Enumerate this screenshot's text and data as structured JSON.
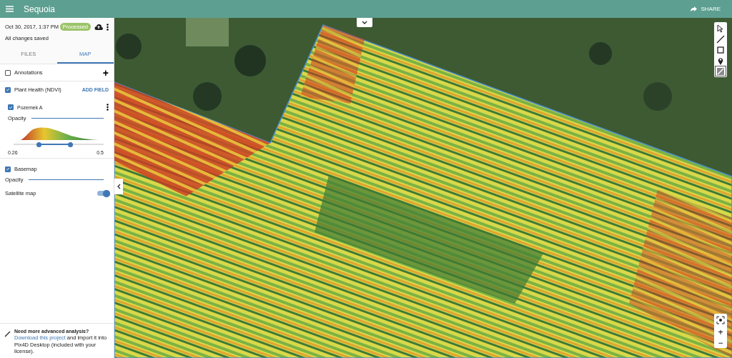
{
  "app_bar": {
    "title": "Sequoia",
    "share_label": "SHARE"
  },
  "project": {
    "date": "Oct 30, 2017, 1:37 PM",
    "status": "Processed",
    "saved_note": "All changes saved"
  },
  "tabs": [
    {
      "label": "FILES",
      "selected": false
    },
    {
      "label": "MAP",
      "selected": true
    }
  ],
  "layers": {
    "annotations": {
      "label": "Annotations",
      "checked": false,
      "action": "+"
    },
    "plant_health": {
      "label": "Plant Health (NDVI)",
      "checked": true,
      "action": "ADD FIELD",
      "fields": [
        {
          "label": "Pozemek A",
          "checked": true,
          "opacity": {
            "label": "Opacity",
            "level": 1
          },
          "range": {
            "thumbs": [
              {
                "level": 0.28
              },
              {
                "level": 0.63
              }
            ],
            "min_label": "0.26",
            "max_label": "0.5"
          }
        }
      ]
    },
    "basemap": {
      "label": "Basemap",
      "checked": true,
      "opacity": {
        "label": "Opacity",
        "level": 1
      },
      "satellite": {
        "label": "Satellite map",
        "on": true
      }
    }
  },
  "footer": {
    "title": "Need more advanced analysis?",
    "link": "Download this project",
    "text": " and import it into Pix4D Desktop (included with your license)."
  },
  "map": {
    "tools": [
      {
        "kind": "select",
        "selected": false
      },
      {
        "kind": "line",
        "selected": false
      },
      {
        "kind": "rectangle",
        "selected": false
      },
      {
        "kind": "marker",
        "selected": false
      },
      {
        "kind": "layer",
        "selected": true
      }
    ],
    "zoom_in": "+",
    "zoom_out": "−"
  }
}
